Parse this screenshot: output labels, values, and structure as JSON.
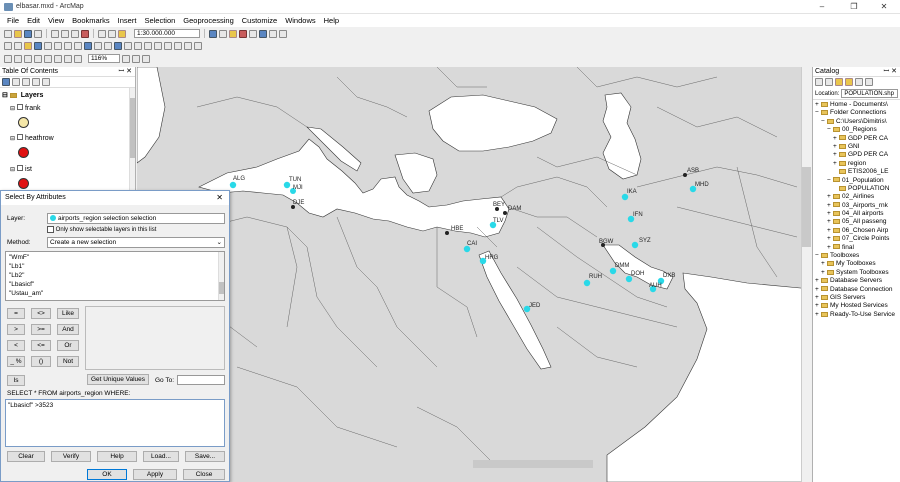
{
  "window": {
    "title": "elbasar.mxd - ArcMap",
    "minimize": "–",
    "maximize": "❐",
    "close": "✕"
  },
  "menu": [
    "File",
    "Edit",
    "View",
    "Bookmarks",
    "Insert",
    "Selection",
    "Geoprocessing",
    "Customize",
    "Windows",
    "Help"
  ],
  "toolbar": {
    "scale": "1:30.000.000",
    "zoom": "116%"
  },
  "toc": {
    "title": "Table Of Contents",
    "root": "Layers",
    "layers": [
      {
        "name": "frank",
        "symbol_color": "#f5e7a8"
      },
      {
        "name": "heathrow",
        "symbol_color": "#e01010"
      },
      {
        "name": "ist",
        "symbol_color": "#e01010"
      }
    ]
  },
  "catalog": {
    "title": "Catalog",
    "location_label": "Location:",
    "location_value": "POPULATION.shp",
    "items": [
      {
        "label": "Home - Documents\\",
        "indent": 0,
        "expander": "+"
      },
      {
        "label": "Folder Connections",
        "indent": 0,
        "expander": "−"
      },
      {
        "label": "C:\\Users\\Dimitris\\",
        "indent": 1,
        "expander": "−"
      },
      {
        "label": "00_Regions",
        "indent": 2,
        "expander": "−"
      },
      {
        "label": "GDP PER CA",
        "indent": 3,
        "expander": "+"
      },
      {
        "label": "GNI",
        "indent": 3,
        "expander": "+"
      },
      {
        "label": "GPD PER CA",
        "indent": 3,
        "expander": "+"
      },
      {
        "label": "region",
        "indent": 3,
        "expander": "+"
      },
      {
        "label": "ETIS2006_LE",
        "indent": 3,
        "expander": ""
      },
      {
        "label": "01_Population",
        "indent": 2,
        "expander": "−"
      },
      {
        "label": "POPULATION",
        "indent": 3,
        "expander": ""
      },
      {
        "label": "02_Airlines",
        "indent": 2,
        "expander": "+"
      },
      {
        "label": "03_Airports_rnk",
        "indent": 2,
        "expander": "+"
      },
      {
        "label": "04_All airports",
        "indent": 2,
        "expander": "+"
      },
      {
        "label": "05_All passeng",
        "indent": 2,
        "expander": "+"
      },
      {
        "label": "06_Chosen Airp",
        "indent": 2,
        "expander": "+"
      },
      {
        "label": "07_Circle Points",
        "indent": 2,
        "expander": "+"
      },
      {
        "label": "final",
        "indent": 2,
        "expander": "+"
      },
      {
        "label": "Toolboxes",
        "indent": 0,
        "expander": "−"
      },
      {
        "label": "My Toolboxes",
        "indent": 1,
        "expander": "+"
      },
      {
        "label": "System Toolboxes",
        "indent": 1,
        "expander": "+"
      },
      {
        "label": "Database Servers",
        "indent": 0,
        "expander": "+"
      },
      {
        "label": "Database Connection",
        "indent": 0,
        "expander": "+"
      },
      {
        "label": "GIS Servers",
        "indent": 0,
        "expander": "+"
      },
      {
        "label": "My Hosted Services",
        "indent": 0,
        "expander": "+"
      },
      {
        "label": "Ready-To-Use Service",
        "indent": 0,
        "expander": "+"
      }
    ]
  },
  "dialog": {
    "title": "Select By Attributes",
    "layer_label": "Layer:",
    "layer_value": "airports_region selection selection",
    "only_selectable": "Only show selectable layers in this list",
    "method_label": "Method:",
    "method_value": "Create a new selection",
    "fields": [
      "\"WmF\"",
      "\"Lb1\"",
      "\"Lb2\"",
      "\"Lbasicf\"",
      "\"Ustau_am\""
    ],
    "operators": [
      "=",
      "<>",
      "Like",
      ">",
      ">=",
      "And",
      "<",
      "<=",
      "Or",
      "_ %",
      "()",
      "Not"
    ],
    "is_button": "Is",
    "get_unique": "Get Unique Values",
    "go_to": "Go To:",
    "select_from": "SELECT * FROM airports_region WHERE:",
    "expression": "\"Lbasicf\" >3523",
    "buttons": {
      "clear": "Clear",
      "verify": "Verify",
      "help": "Help",
      "load": "Load...",
      "save": "Save..."
    },
    "ok": "OK",
    "apply": "Apply",
    "close": "Close"
  },
  "map": {
    "water_color": "#ffffff",
    "land_color": "#d9d9d9",
    "airport_color": "#29d9e8",
    "airports": [
      {
        "code": "ALG"
      },
      {
        "code": "TUN"
      },
      {
        "code": "MJI"
      },
      {
        "code": "DJE"
      },
      {
        "code": "BEY"
      },
      {
        "code": "DAM"
      },
      {
        "code": "TLV"
      },
      {
        "code": "HBE"
      },
      {
        "code": "CAI"
      },
      {
        "code": "HRG"
      },
      {
        "code": "JED"
      },
      {
        "code": "BGW"
      },
      {
        "code": "IKA"
      },
      {
        "code": "IFN"
      },
      {
        "code": "SYZ"
      },
      {
        "code": "ASB"
      },
      {
        "code": "MHD"
      },
      {
        "code": "RUH"
      },
      {
        "code": "DMM"
      },
      {
        "code": "DOH"
      },
      {
        "code": "DXB"
      },
      {
        "code": "AUH"
      }
    ]
  }
}
